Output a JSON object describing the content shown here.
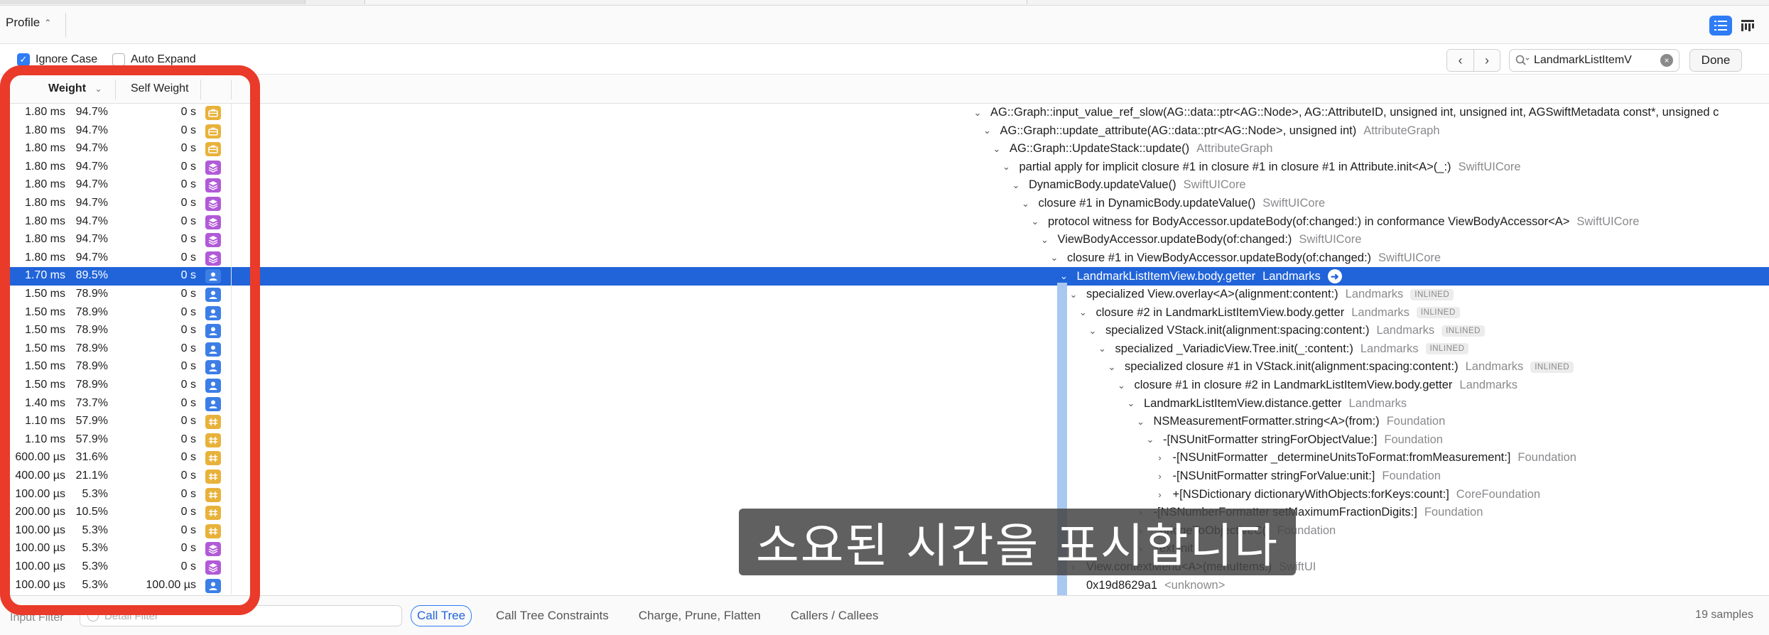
{
  "toolbar": {
    "profile_label": "Profile"
  },
  "options": {
    "ignore_case_label": "Ignore Case",
    "ignore_case_checked": true,
    "auto_expand_label": "Auto Expand",
    "auto_expand_checked": false,
    "search_value": "LandmarkListItemV",
    "done_label": "Done"
  },
  "columns": {
    "weight": "Weight",
    "self_weight": "Self Weight"
  },
  "colors": {
    "accent": "#2f7cf6",
    "selection": "#2164d9",
    "highlight": "#ea3a2a",
    "yellow": "#e8b23a",
    "purple": "#b15ad8",
    "blue": "#3c7ee6"
  },
  "rows": [
    {
      "weight": "1.80 ms",
      "pct": "94.7%",
      "self": "0 s",
      "icon": "toolbox-icon",
      "depth": 0,
      "symbol": "AG::Graph::input_value_ref_slow(AG::data::ptr<AG::Node>, AG::AttributeID, unsigned int, unsigned int, AGSwiftMetadata const*, unsigned c",
      "library": "",
      "inlined": false
    },
    {
      "weight": "1.80 ms",
      "pct": "94.7%",
      "self": "0 s",
      "icon": "toolbox-icon",
      "depth": 1,
      "symbol": "AG::Graph::update_attribute(AG::data::ptr<AG::Node>, unsigned int)",
      "library": "AttributeGraph",
      "inlined": false
    },
    {
      "weight": "1.80 ms",
      "pct": "94.7%",
      "self": "0 s",
      "icon": "toolbox-icon",
      "depth": 2,
      "symbol": "AG::Graph::UpdateStack::update()",
      "library": "AttributeGraph",
      "inlined": false
    },
    {
      "weight": "1.80 ms",
      "pct": "94.7%",
      "self": "0 s",
      "icon": "layers-icon",
      "depth": 3,
      "symbol": "partial apply for implicit closure #1 in closure #1 in closure #1 in Attribute.init<A>(_:)",
      "library": "SwiftUICore",
      "inlined": false
    },
    {
      "weight": "1.80 ms",
      "pct": "94.7%",
      "self": "0 s",
      "icon": "layers-icon",
      "depth": 4,
      "symbol": "DynamicBody.updateValue()",
      "library": "SwiftUICore",
      "inlined": false
    },
    {
      "weight": "1.80 ms",
      "pct": "94.7%",
      "self": "0 s",
      "icon": "layers-icon",
      "depth": 5,
      "symbol": "closure #1 in DynamicBody.updateValue()",
      "library": "SwiftUICore",
      "inlined": false
    },
    {
      "weight": "1.80 ms",
      "pct": "94.7%",
      "self": "0 s",
      "icon": "layers-icon",
      "depth": 6,
      "symbol": "protocol witness for BodyAccessor.updateBody(of:changed:) in conformance ViewBodyAccessor<A>",
      "library": "SwiftUICore",
      "inlined": false
    },
    {
      "weight": "1.80 ms",
      "pct": "94.7%",
      "self": "0 s",
      "icon": "layers-icon",
      "depth": 7,
      "symbol": "ViewBodyAccessor.updateBody(of:changed:)",
      "library": "SwiftUICore",
      "inlined": false
    },
    {
      "weight": "1.80 ms",
      "pct": "94.7%",
      "self": "0 s",
      "icon": "layers-icon",
      "depth": 8,
      "symbol": "closure #1 in ViewBodyAccessor.updateBody(of:changed:)",
      "library": "SwiftUICore",
      "inlined": false
    },
    {
      "weight": "1.70 ms",
      "pct": "89.5%",
      "self": "0 s",
      "icon": "user-icon",
      "depth": 9,
      "symbol": "LandmarkListItemView.body.getter",
      "library": "Landmarks",
      "inlined": false,
      "selected": true
    },
    {
      "weight": "1.50 ms",
      "pct": "78.9%",
      "self": "0 s",
      "icon": "user-icon",
      "depth": 10,
      "symbol": "specialized View.overlay<A>(alignment:content:)",
      "library": "Landmarks",
      "inlined": true
    },
    {
      "weight": "1.50 ms",
      "pct": "78.9%",
      "self": "0 s",
      "icon": "user-icon",
      "depth": 11,
      "symbol": "closure #2 in LandmarkListItemView.body.getter",
      "library": "Landmarks",
      "inlined": true
    },
    {
      "weight": "1.50 ms",
      "pct": "78.9%",
      "self": "0 s",
      "icon": "user-icon",
      "depth": 12,
      "symbol": "specialized VStack.init(alignment:spacing:content:)",
      "library": "Landmarks",
      "inlined": true
    },
    {
      "weight": "1.50 ms",
      "pct": "78.9%",
      "self": "0 s",
      "icon": "user-icon",
      "depth": 13,
      "symbol": "specialized _VariadicView.Tree.init(_:content:)",
      "library": "Landmarks",
      "inlined": true
    },
    {
      "weight": "1.50 ms",
      "pct": "78.9%",
      "self": "0 s",
      "icon": "user-icon",
      "depth": 14,
      "symbol": "specialized closure #1 in VStack.init(alignment:spacing:content:)",
      "library": "Landmarks",
      "inlined": true
    },
    {
      "weight": "1.50 ms",
      "pct": "78.9%",
      "self": "0 s",
      "icon": "user-icon",
      "depth": 15,
      "symbol": "closure #1 in closure #2 in LandmarkListItemView.body.getter",
      "library": "Landmarks",
      "inlined": false
    },
    {
      "weight": "1.40 ms",
      "pct": "73.7%",
      "self": "0 s",
      "icon": "user-icon",
      "depth": 16,
      "symbol": "LandmarkListItemView.distance.getter",
      "library": "Landmarks",
      "inlined": false
    },
    {
      "weight": "1.10 ms",
      "pct": "57.9%",
      "self": "0 s",
      "icon": "foundation-icon",
      "depth": 17,
      "symbol": "NSMeasurementFormatter.string<A>(from:)",
      "library": "Foundation",
      "inlined": false
    },
    {
      "weight": "1.10 ms",
      "pct": "57.9%",
      "self": "0 s",
      "icon": "foundation-icon",
      "depth": 18,
      "symbol": "-[NSUnitFormatter stringForObjectValue:]",
      "library": "Foundation",
      "inlined": false
    },
    {
      "weight": "600.00 µs",
      "pct": "31.6%",
      "self": "0 s",
      "icon": "foundation-icon",
      "depth": 19,
      "symbol": "-[NSUnitFormatter _determineUnitsToFormat:fromMeasurement:]",
      "library": "Foundation",
      "inlined": false,
      "collapsed": true
    },
    {
      "weight": "400.00 µs",
      "pct": "21.1%",
      "self": "0 s",
      "icon": "foundation-icon",
      "depth": 19,
      "symbol": "-[NSUnitFormatter stringForValue:unit:]",
      "library": "Foundation",
      "inlined": false,
      "collapsed": true
    },
    {
      "weight": "100.00 µs",
      "pct": "5.3%",
      "self": "0 s",
      "icon": "foundation-icon",
      "depth": 19,
      "symbol": "+[NSDictionary dictionaryWithObjects:forKeys:count:]",
      "library": "CoreFoundation",
      "inlined": false,
      "collapsed": true
    },
    {
      "weight": "200.00 µs",
      "pct": "10.5%",
      "self": "0 s",
      "icon": "foundation-icon",
      "depth": 17,
      "symbol": "-[NSNumberFormatter setMaximumFractionDigits:]",
      "library": "Foundation",
      "inlined": false,
      "collapsed": true
    },
    {
      "weight": "100.00 µs",
      "pct": "5.3%",
      "self": "0 s",
      "icon": "foundation-icon",
      "depth": 17,
      "symbol": "_bridgeToObjectiveC()",
      "library": "Foundation",
      "inlined": false,
      "collapsed": true
    },
    {
      "weight": "100.00 µs",
      "pct": "5.3%",
      "self": "0 s",
      "icon": "layers-icon",
      "depth": 17,
      "symbol": "Text.init",
      "library": "",
      "inlined": false,
      "collapsed": true
    },
    {
      "weight": "100.00 µs",
      "pct": "5.3%",
      "self": "0 s",
      "icon": "layers-icon",
      "depth": 10,
      "symbol": "View.contextMenu<A>(menuItems:)",
      "library": "SwiftUI",
      "inlined": false,
      "collapsed": true
    },
    {
      "weight": "100.00 µs",
      "pct": "5.3%",
      "self": "100.00 µs",
      "icon": "user-icon",
      "depth": 10,
      "symbol": "0x19d8629a1",
      "library": "<unknown>",
      "inlined": false,
      "leaf": true
    }
  ],
  "inlined_label": "INLINED",
  "bottom": {
    "input_filter_label": "Input Filter",
    "filter_placeholder": "Detail Filter",
    "tabs": [
      "Call Tree",
      "Call Tree Constraints",
      "Charge, Prune, Flatten",
      "Callers / Callees"
    ],
    "samples": "19 samples"
  },
  "caption": "소요된 시간을 표시합니다"
}
